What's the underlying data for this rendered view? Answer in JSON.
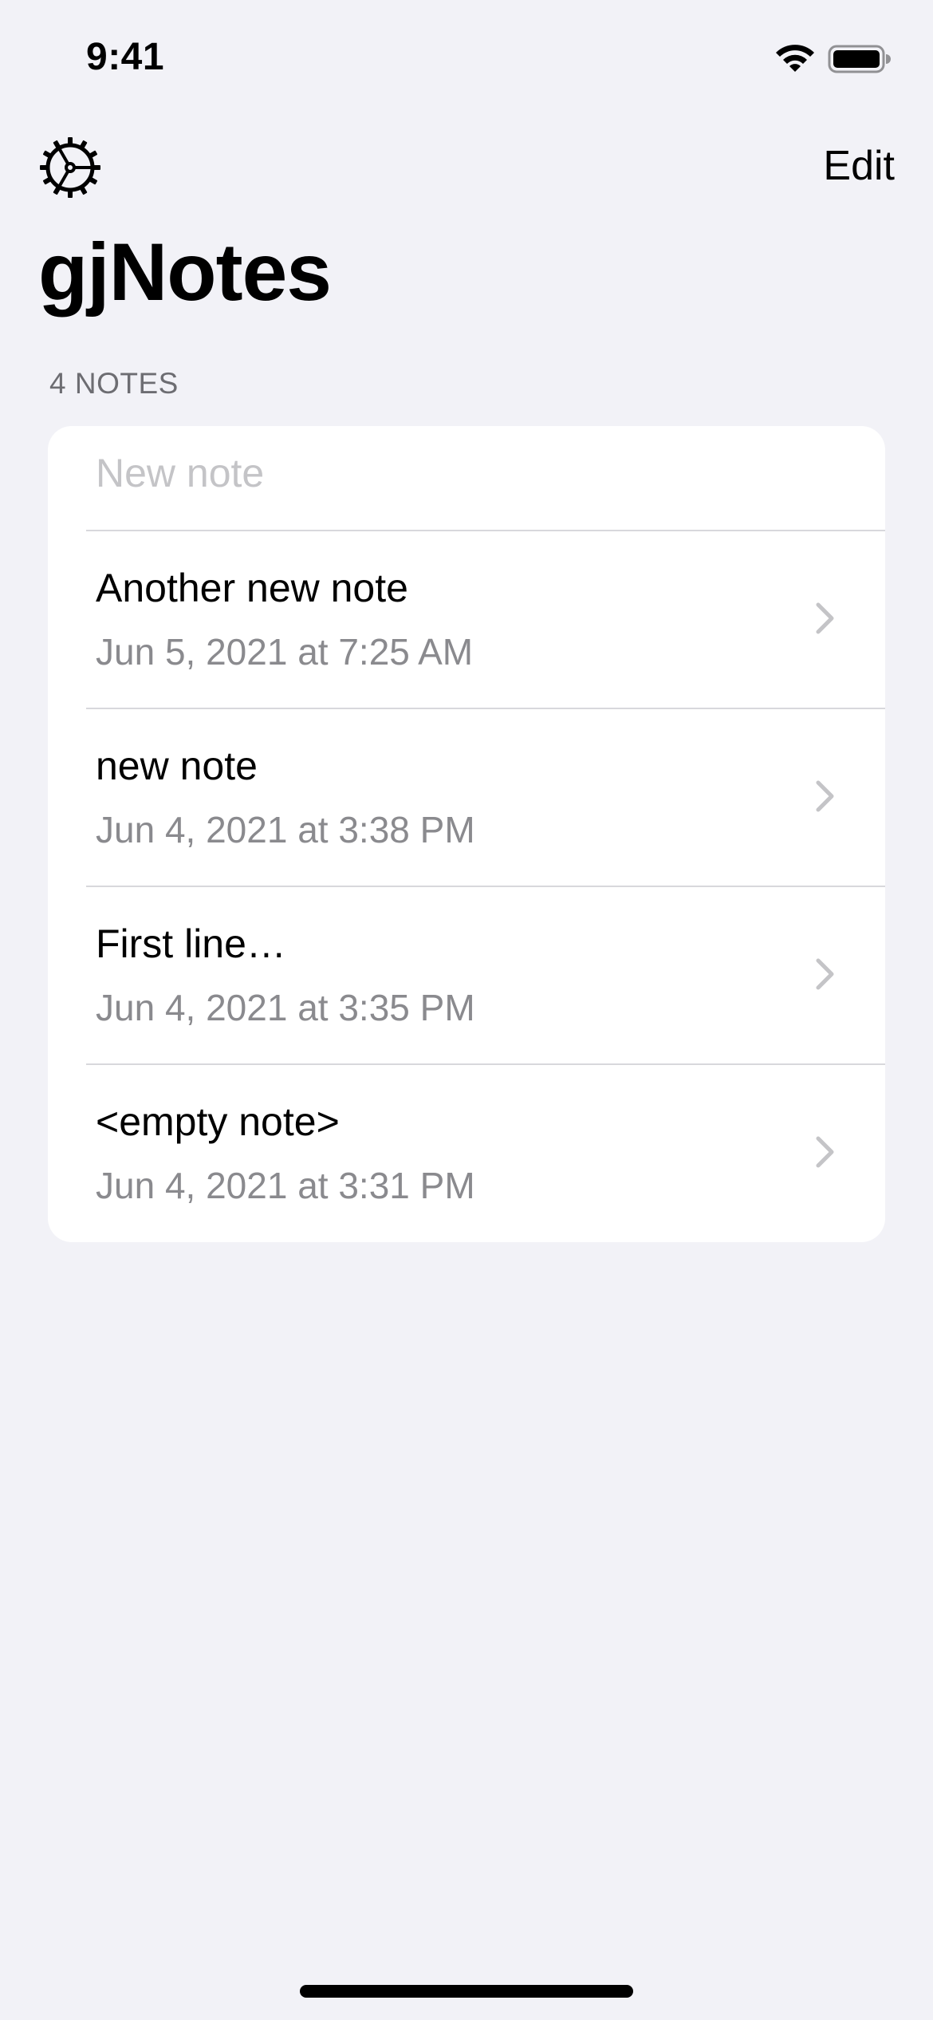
{
  "status_bar": {
    "time": "9:41",
    "wifi_icon": "wifi-icon",
    "battery_icon": "battery-icon"
  },
  "nav": {
    "settings_icon": "gear-icon",
    "edit_label": "Edit"
  },
  "title": "gjNotes",
  "section_header": "4 NOTES",
  "new_note": {
    "placeholder": "New note",
    "value": ""
  },
  "notes": [
    {
      "title": "Another new note",
      "date": "Jun 5, 2021 at 7:25 AM"
    },
    {
      "title": "new note",
      "date": "Jun 4, 2021 at 3:38 PM"
    },
    {
      "title": "First line…",
      "date": "Jun 4, 2021 at 3:35 PM"
    },
    {
      "title": "<empty note>",
      "date": "Jun 4, 2021 at 3:31 PM"
    }
  ],
  "colors": {
    "background": "#f2f2f7",
    "card": "#ffffff",
    "secondary_text": "#8a8a8e",
    "section_header": "#6d6d72",
    "placeholder": "#c4c4c7",
    "separator": "#d8d8dc",
    "chevron": "#c4c4c7"
  }
}
